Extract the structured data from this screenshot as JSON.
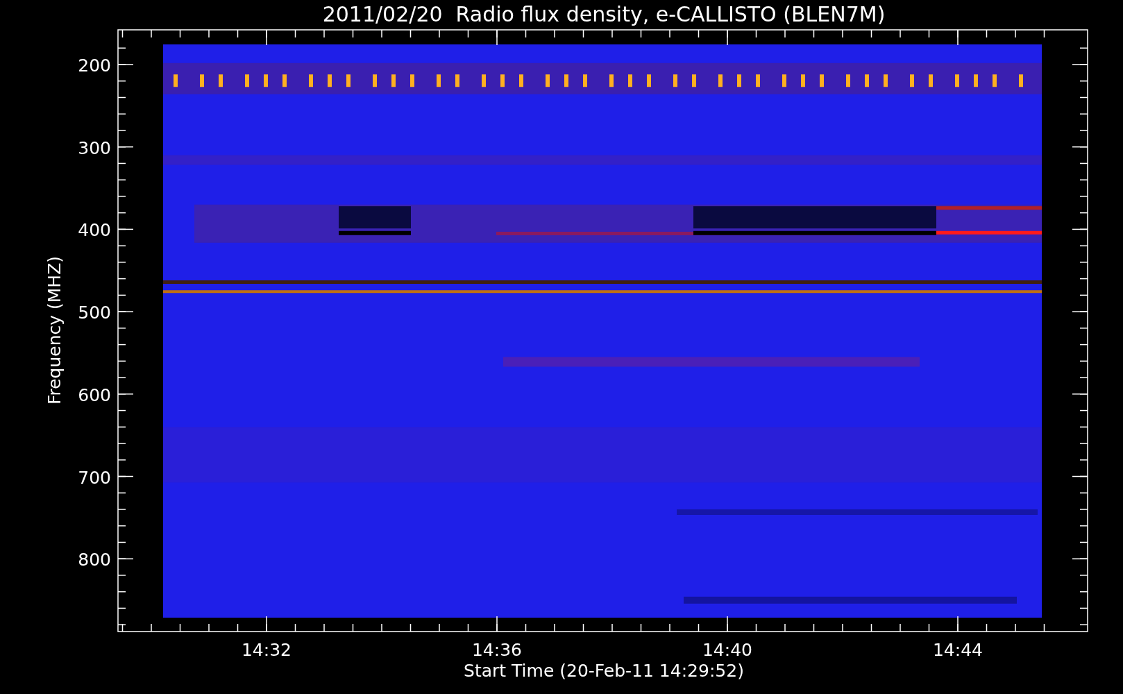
{
  "title": "2011/02/20  Radio flux density, e-CALLISTO (BLEN7M)",
  "y_axis": {
    "label": "Frequency (MHZ)",
    "ticks": [
      "200",
      "300",
      "400",
      "500",
      "600",
      "700",
      "800"
    ]
  },
  "x_axis": {
    "label": "Start Time (20-Feb-11 14:29:52)",
    "ticks": [
      "14:32",
      "14:36",
      "14:40",
      "14:44"
    ]
  }
}
